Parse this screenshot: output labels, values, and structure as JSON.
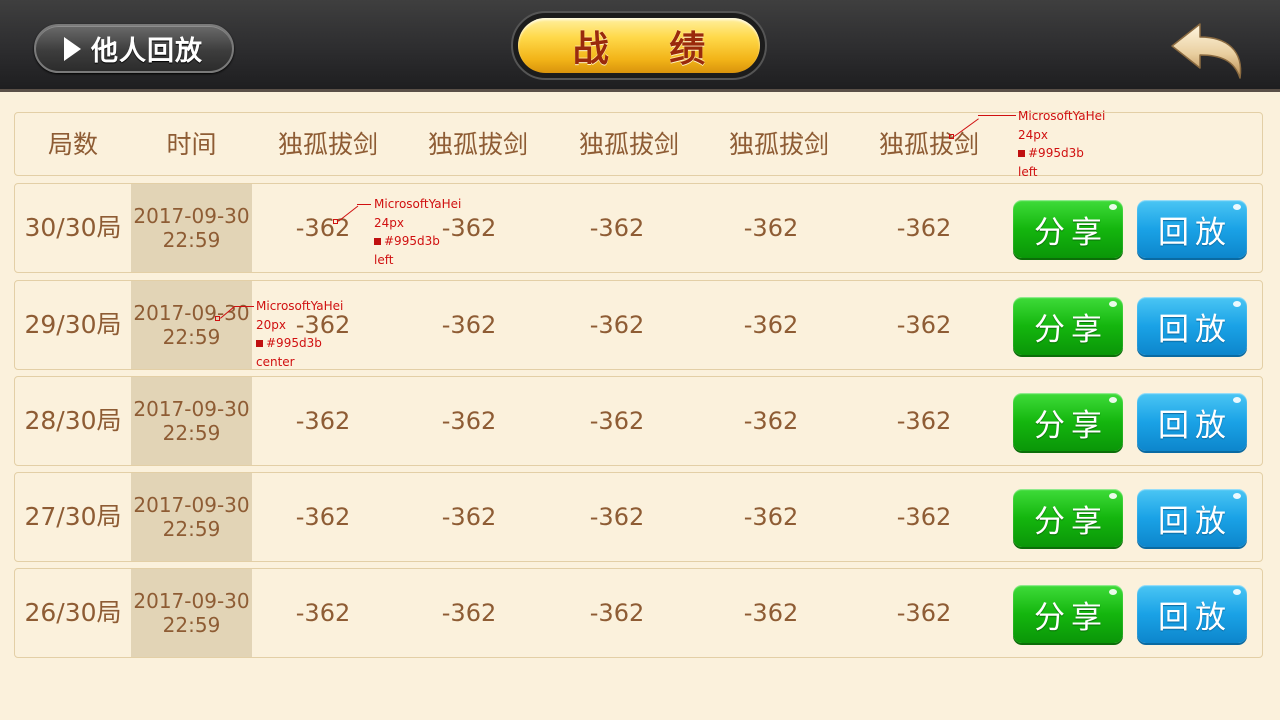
{
  "topbar": {
    "replay_others_label": "他人回放",
    "title": "战 绩"
  },
  "table": {
    "headers": [
      "局数",
      "时间",
      "独孤拔剑",
      "独孤拔剑",
      "独孤拔剑",
      "独孤拔剑",
      "独孤拔剑"
    ],
    "rows": [
      {
        "round": "30/30局",
        "date": "2017-09-30",
        "time": "22:59",
        "scores": [
          "-362",
          "-362",
          "-362",
          "-362",
          "-362"
        ]
      },
      {
        "round": "29/30局",
        "date": "2017-09-30",
        "time": "22:59",
        "scores": [
          "-362",
          "-362",
          "-362",
          "-362",
          "-362"
        ]
      },
      {
        "round": "28/30局",
        "date": "2017-09-30",
        "time": "22:59",
        "scores": [
          "-362",
          "-362",
          "-362",
          "-362",
          "-362"
        ]
      },
      {
        "round": "27/30局",
        "date": "2017-09-30",
        "time": "22:59",
        "scores": [
          "-362",
          "-362",
          "-362",
          "-362",
          "-362"
        ]
      },
      {
        "round": "26/30局",
        "date": "2017-09-30",
        "time": "22:59",
        "scores": [
          "-362",
          "-362",
          "-362",
          "-362",
          "-362"
        ]
      }
    ],
    "share_label": "分享",
    "replay_label": "回放"
  },
  "annotations": [
    {
      "font": "MicrosoftYaHei",
      "size": "24px",
      "color": "#995d3b",
      "align": "left"
    },
    {
      "font": "MicrosoftYaHei",
      "size": "24px",
      "color": "#995d3b",
      "align": "left"
    },
    {
      "font": "MicrosoftYaHei",
      "size": "20px",
      "color": "#995d3b",
      "align": "center"
    }
  ],
  "colors": {
    "text": "#8e5c34",
    "share": "#14b60e",
    "replay": "#1aa2e6",
    "title_gold": "#f2b418"
  }
}
